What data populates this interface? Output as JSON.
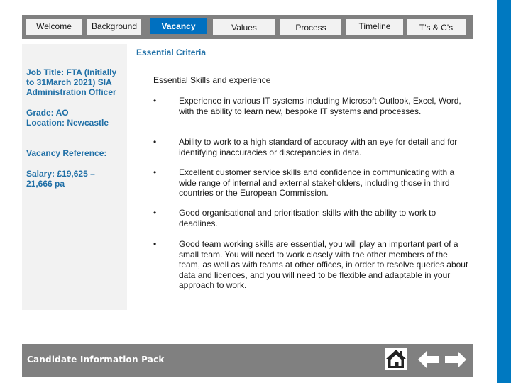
{
  "nav": {
    "tabs": [
      {
        "label": "Welcome",
        "active": false
      },
      {
        "label": "Background",
        "active": false
      },
      {
        "label": "Vacancy",
        "active": true
      },
      {
        "label": "Values",
        "active": false
      },
      {
        "label": "Process",
        "active": false
      },
      {
        "label": "Timeline",
        "active": false
      },
      {
        "label": "T's & C's",
        "active": false
      }
    ]
  },
  "sidebar": {
    "job_title": "Job Title: FTA (Initially to 31March 2021) SIA Administration Officer",
    "grade": "Grade: AO",
    "location": "Location: Newcastle",
    "vacancy_reference": "Vacancy Reference:",
    "salary": "Salary: £19,625 – 21,666 pa"
  },
  "main": {
    "section_title": "Essential Criteria",
    "subheading": "Essential Skills and experience",
    "bullet_glyph": "•",
    "bullets": [
      "Experience in various IT systems including Microsoft Outlook, Excel, Word, with the ability to learn new, bespoke IT systems and processes.",
      "Ability to work to a high standard of accuracy with an eye for detail and for identifying inaccuracies or discrepancies in data.",
      "Excellent customer service skills and confidence in communicating with a wide range of internal and external stakeholders, including those in third countries or the European Commission.",
      "Good organisational and prioritisation skills with the ability to work to deadlines.",
      "Good team working skills are essential, you will play an important part of a small team. You will need to work closely with the other members of the team, as well as with teams at other offices, in order to resolve queries about data and licences, and you will need to be flexible and adaptable in your approach to work."
    ]
  },
  "footer": {
    "title": "Candidate Information Pack",
    "home_icon": "home-icon",
    "back_icon": "arrow-left-icon",
    "next_icon": "arrow-right-icon"
  },
  "colors": {
    "accent_blue": "#0070c0",
    "stripe_blue": "#0079c1",
    "bar_gray": "#808080",
    "panel_gray": "#f2f2f2",
    "heading_blue": "#1f6fa6"
  }
}
